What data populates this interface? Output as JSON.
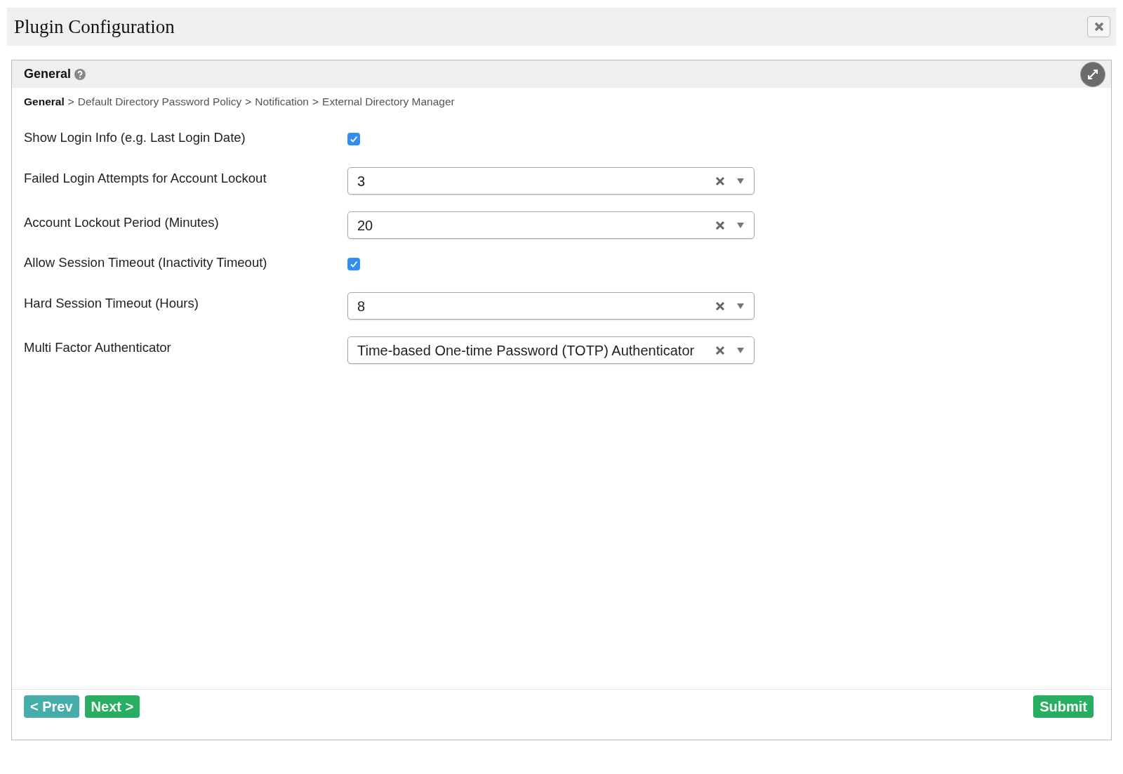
{
  "window": {
    "title": "Plugin Configuration"
  },
  "section": {
    "title": "General"
  },
  "breadcrumb": {
    "separator": ">",
    "items": [
      {
        "label": "General",
        "selected": true
      },
      {
        "label": "Default Directory Password Policy",
        "selected": false
      },
      {
        "label": "Notification",
        "selected": false
      },
      {
        "label": "External Directory Manager",
        "selected": false
      }
    ]
  },
  "fields": [
    {
      "kind": "checkbox",
      "label": "Show Login Info (e.g. Last Login Date)",
      "checked": true
    },
    {
      "kind": "select",
      "label": "Failed Login Attempts for Account Lockout",
      "value": "3"
    },
    {
      "kind": "select",
      "label": "Account Lockout Period (Minutes)",
      "value": "20"
    },
    {
      "kind": "checkbox",
      "label": "Allow Session Timeout (Inactivity Timeout)",
      "checked": true
    },
    {
      "kind": "select",
      "label": "Hard Session Timeout (Hours)",
      "value": "8"
    },
    {
      "kind": "select",
      "label": "Multi Factor Authenticator",
      "value": "Time-based One-time Password (TOTP) Authenticator"
    }
  ],
  "buttons": {
    "prev": "< Prev",
    "next": "Next >",
    "submit": "Submit"
  }
}
